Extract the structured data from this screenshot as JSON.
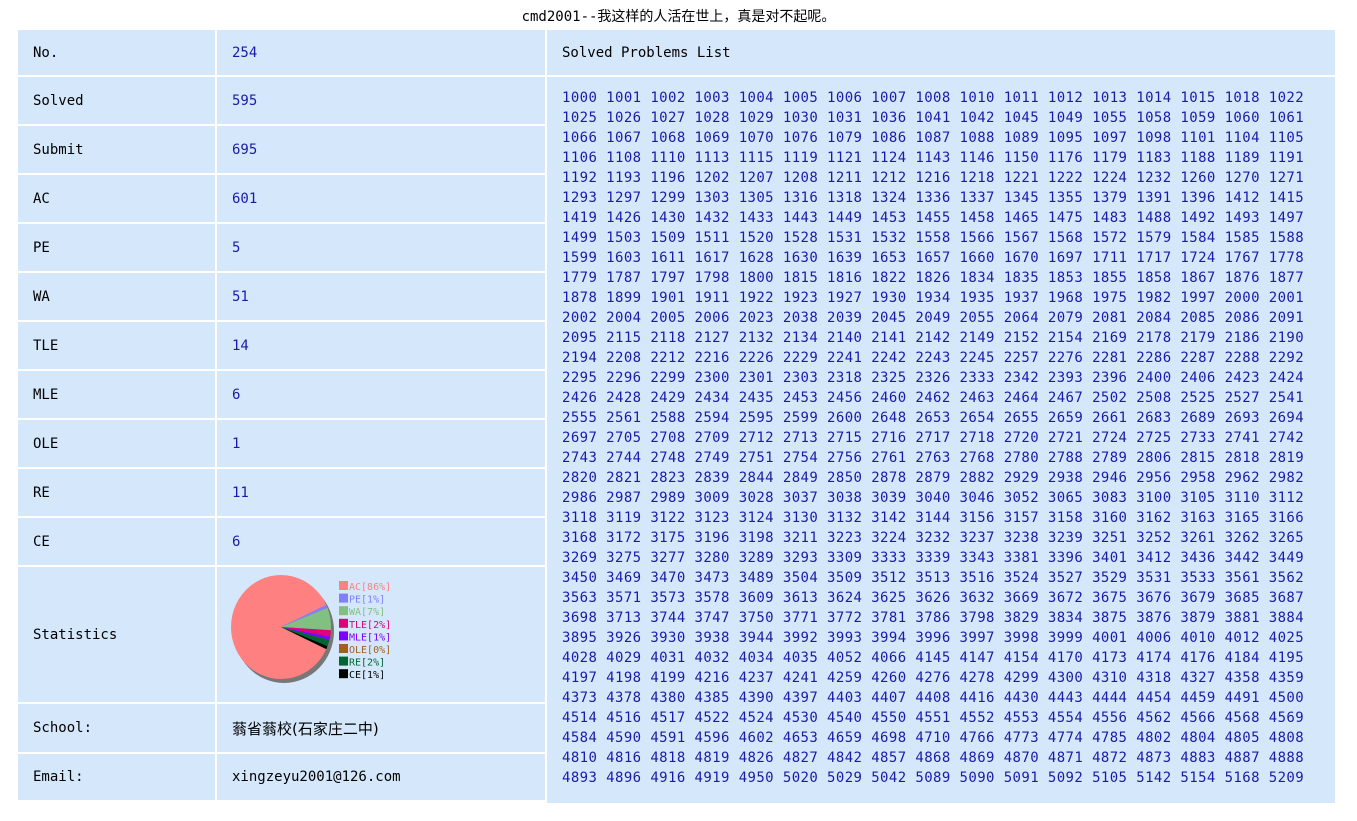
{
  "header": {
    "title": "cmd2001--我这样的人活在世上，真是对不起呢。"
  },
  "info": [
    {
      "label": "No.",
      "value": "254"
    },
    {
      "label": "Solved",
      "value": "595"
    },
    {
      "label": "Submit",
      "value": "695"
    },
    {
      "label": "AC",
      "value": "601"
    },
    {
      "label": "PE",
      "value": "5"
    },
    {
      "label": "WA",
      "value": "51"
    },
    {
      "label": "TLE",
      "value": "14"
    },
    {
      "label": "MLE",
      "value": "6"
    },
    {
      "label": "OLE",
      "value": "1"
    },
    {
      "label": "RE",
      "value": "11"
    },
    {
      "label": "CE",
      "value": "6"
    }
  ],
  "statistics": {
    "label": "Statistics",
    "chart_type": "pie",
    "slices": [
      {
        "name": "AC[86%]",
        "percent": 86,
        "color": "#ff8080"
      },
      {
        "name": "PE[1%]",
        "percent": 1,
        "color": "#8080ff"
      },
      {
        "name": "WA[7%]",
        "percent": 7,
        "color": "#80c080"
      },
      {
        "name": "TLE[2%]",
        "percent": 2,
        "color": "#e0007a"
      },
      {
        "name": "MLE[1%]",
        "percent": 1,
        "color": "#8000ff"
      },
      {
        "name": "OLE[0%]",
        "percent": 0,
        "color": "#a06020"
      },
      {
        "name": "RE[2%]",
        "percent": 2,
        "color": "#006633"
      },
      {
        "name": "CE[1%]",
        "percent": 1,
        "color": "#000000"
      }
    ]
  },
  "school": {
    "label": "School:",
    "value": "蓊省蓊校(石家庄二中)"
  },
  "email": {
    "label": "Email:",
    "value": "xingzeyu2001@126.com"
  },
  "solved_list": {
    "heading": "Solved Problems List",
    "problems": [
      "1000",
      "1001",
      "1002",
      "1003",
      "1004",
      "1005",
      "1006",
      "1007",
      "1008",
      "1010",
      "1011",
      "1012",
      "1013",
      "1014",
      "1015",
      "1018",
      "1022",
      "1025",
      "1026",
      "1027",
      "1028",
      "1029",
      "1030",
      "1031",
      "1036",
      "1041",
      "1042",
      "1045",
      "1049",
      "1055",
      "1058",
      "1059",
      "1060",
      "1061",
      "1066",
      "1067",
      "1068",
      "1069",
      "1070",
      "1076",
      "1079",
      "1086",
      "1087",
      "1088",
      "1089",
      "1095",
      "1097",
      "1098",
      "1101",
      "1104",
      "1105",
      "1106",
      "1108",
      "1110",
      "1113",
      "1115",
      "1119",
      "1121",
      "1124",
      "1143",
      "1146",
      "1150",
      "1176",
      "1179",
      "1183",
      "1188",
      "1189",
      "1191",
      "1192",
      "1193",
      "1196",
      "1202",
      "1207",
      "1208",
      "1211",
      "1212",
      "1216",
      "1218",
      "1221",
      "1222",
      "1224",
      "1232",
      "1260",
      "1270",
      "1271",
      "1293",
      "1297",
      "1299",
      "1303",
      "1305",
      "1316",
      "1318",
      "1324",
      "1336",
      "1337",
      "1345",
      "1355",
      "1379",
      "1391",
      "1396",
      "1412",
      "1415",
      "1419",
      "1426",
      "1430",
      "1432",
      "1433",
      "1443",
      "1449",
      "1453",
      "1455",
      "1458",
      "1465",
      "1475",
      "1483",
      "1488",
      "1492",
      "1493",
      "1497",
      "1499",
      "1503",
      "1509",
      "1511",
      "1520",
      "1528",
      "1531",
      "1532",
      "1558",
      "1566",
      "1567",
      "1568",
      "1572",
      "1579",
      "1584",
      "1585",
      "1588",
      "1599",
      "1603",
      "1611",
      "1617",
      "1628",
      "1630",
      "1639",
      "1653",
      "1657",
      "1660",
      "1670",
      "1697",
      "1711",
      "1717",
      "1724",
      "1767",
      "1778",
      "1779",
      "1787",
      "1797",
      "1798",
      "1800",
      "1815",
      "1816",
      "1822",
      "1826",
      "1834",
      "1835",
      "1853",
      "1855",
      "1858",
      "1867",
      "1876",
      "1877",
      "1878",
      "1899",
      "1901",
      "1911",
      "1922",
      "1923",
      "1927",
      "1930",
      "1934",
      "1935",
      "1937",
      "1968",
      "1975",
      "1982",
      "1997",
      "2000",
      "2001",
      "2002",
      "2004",
      "2005",
      "2006",
      "2023",
      "2038",
      "2039",
      "2045",
      "2049",
      "2055",
      "2064",
      "2079",
      "2081",
      "2084",
      "2085",
      "2086",
      "2091",
      "2095",
      "2115",
      "2118",
      "2127",
      "2132",
      "2134",
      "2140",
      "2141",
      "2142",
      "2149",
      "2152",
      "2154",
      "2169",
      "2178",
      "2179",
      "2186",
      "2190",
      "2194",
      "2208",
      "2212",
      "2216",
      "2226",
      "2229",
      "2241",
      "2242",
      "2243",
      "2245",
      "2257",
      "2276",
      "2281",
      "2286",
      "2287",
      "2288",
      "2292",
      "2295",
      "2296",
      "2299",
      "2300",
      "2301",
      "2303",
      "2318",
      "2325",
      "2326",
      "2333",
      "2342",
      "2393",
      "2396",
      "2400",
      "2406",
      "2423",
      "2424",
      "2426",
      "2428",
      "2429",
      "2434",
      "2435",
      "2453",
      "2456",
      "2460",
      "2462",
      "2463",
      "2464",
      "2467",
      "2502",
      "2508",
      "2525",
      "2527",
      "2541",
      "2555",
      "2561",
      "2588",
      "2594",
      "2595",
      "2599",
      "2600",
      "2648",
      "2653",
      "2654",
      "2655",
      "2659",
      "2661",
      "2683",
      "2689",
      "2693",
      "2694",
      "2697",
      "2705",
      "2708",
      "2709",
      "2712",
      "2713",
      "2715",
      "2716",
      "2717",
      "2718",
      "2720",
      "2721",
      "2724",
      "2725",
      "2733",
      "2741",
      "2742",
      "2743",
      "2744",
      "2748",
      "2749",
      "2751",
      "2754",
      "2756",
      "2761",
      "2763",
      "2768",
      "2780",
      "2788",
      "2789",
      "2806",
      "2815",
      "2818",
      "2819",
      "2820",
      "2821",
      "2823",
      "2839",
      "2844",
      "2849",
      "2850",
      "2878",
      "2879",
      "2882",
      "2929",
      "2938",
      "2946",
      "2956",
      "2958",
      "2962",
      "2982",
      "2986",
      "2987",
      "2989",
      "3009",
      "3028",
      "3037",
      "3038",
      "3039",
      "3040",
      "3046",
      "3052",
      "3065",
      "3083",
      "3100",
      "3105",
      "3110",
      "3112",
      "3118",
      "3119",
      "3122",
      "3123",
      "3124",
      "3130",
      "3132",
      "3142",
      "3144",
      "3156",
      "3157",
      "3158",
      "3160",
      "3162",
      "3163",
      "3165",
      "3166",
      "3168",
      "3172",
      "3175",
      "3196",
      "3198",
      "3211",
      "3223",
      "3224",
      "3232",
      "3237",
      "3238",
      "3239",
      "3251",
      "3252",
      "3261",
      "3262",
      "3265",
      "3269",
      "3275",
      "3277",
      "3280",
      "3289",
      "3293",
      "3309",
      "3333",
      "3339",
      "3343",
      "3381",
      "3396",
      "3401",
      "3412",
      "3436",
      "3442",
      "3449",
      "3450",
      "3469",
      "3470",
      "3473",
      "3489",
      "3504",
      "3509",
      "3512",
      "3513",
      "3516",
      "3524",
      "3527",
      "3529",
      "3531",
      "3533",
      "3561",
      "3562",
      "3563",
      "3571",
      "3573",
      "3578",
      "3609",
      "3613",
      "3624",
      "3625",
      "3626",
      "3632",
      "3669",
      "3672",
      "3675",
      "3676",
      "3679",
      "3685",
      "3687",
      "3698",
      "3713",
      "3744",
      "3747",
      "3750",
      "3771",
      "3772",
      "3781",
      "3786",
      "3798",
      "3829",
      "3834",
      "3875",
      "3876",
      "3879",
      "3881",
      "3884",
      "3895",
      "3926",
      "3930",
      "3938",
      "3944",
      "3992",
      "3993",
      "3994",
      "3996",
      "3997",
      "3998",
      "3999",
      "4001",
      "4006",
      "4010",
      "4012",
      "4025",
      "4028",
      "4029",
      "4031",
      "4032",
      "4034",
      "4035",
      "4052",
      "4066",
      "4145",
      "4147",
      "4154",
      "4170",
      "4173",
      "4174",
      "4176",
      "4184",
      "4195",
      "4197",
      "4198",
      "4199",
      "4216",
      "4237",
      "4241",
      "4259",
      "4260",
      "4276",
      "4278",
      "4299",
      "4300",
      "4310",
      "4318",
      "4327",
      "4358",
      "4359",
      "4373",
      "4378",
      "4380",
      "4385",
      "4390",
      "4397",
      "4403",
      "4407",
      "4408",
      "4416",
      "4430",
      "4443",
      "4444",
      "4454",
      "4459",
      "4491",
      "4500",
      "4514",
      "4516",
      "4517",
      "4522",
      "4524",
      "4530",
      "4540",
      "4550",
      "4551",
      "4552",
      "4553",
      "4554",
      "4556",
      "4562",
      "4566",
      "4568",
      "4569",
      "4584",
      "4590",
      "4591",
      "4596",
      "4602",
      "4653",
      "4659",
      "4698",
      "4710",
      "4766",
      "4773",
      "4774",
      "4785",
      "4802",
      "4804",
      "4805",
      "4808",
      "4810",
      "4816",
      "4818",
      "4819",
      "4826",
      "4827",
      "4842",
      "4857",
      "4868",
      "4869",
      "4870",
      "4871",
      "4872",
      "4873",
      "4883",
      "4887",
      "4888",
      "4893",
      "4896",
      "4916",
      "4919",
      "4950",
      "5020",
      "5029",
      "5042",
      "5089",
      "5090",
      "5091",
      "5092",
      "5105",
      "5142",
      "5154",
      "5168",
      "5209"
    ]
  }
}
